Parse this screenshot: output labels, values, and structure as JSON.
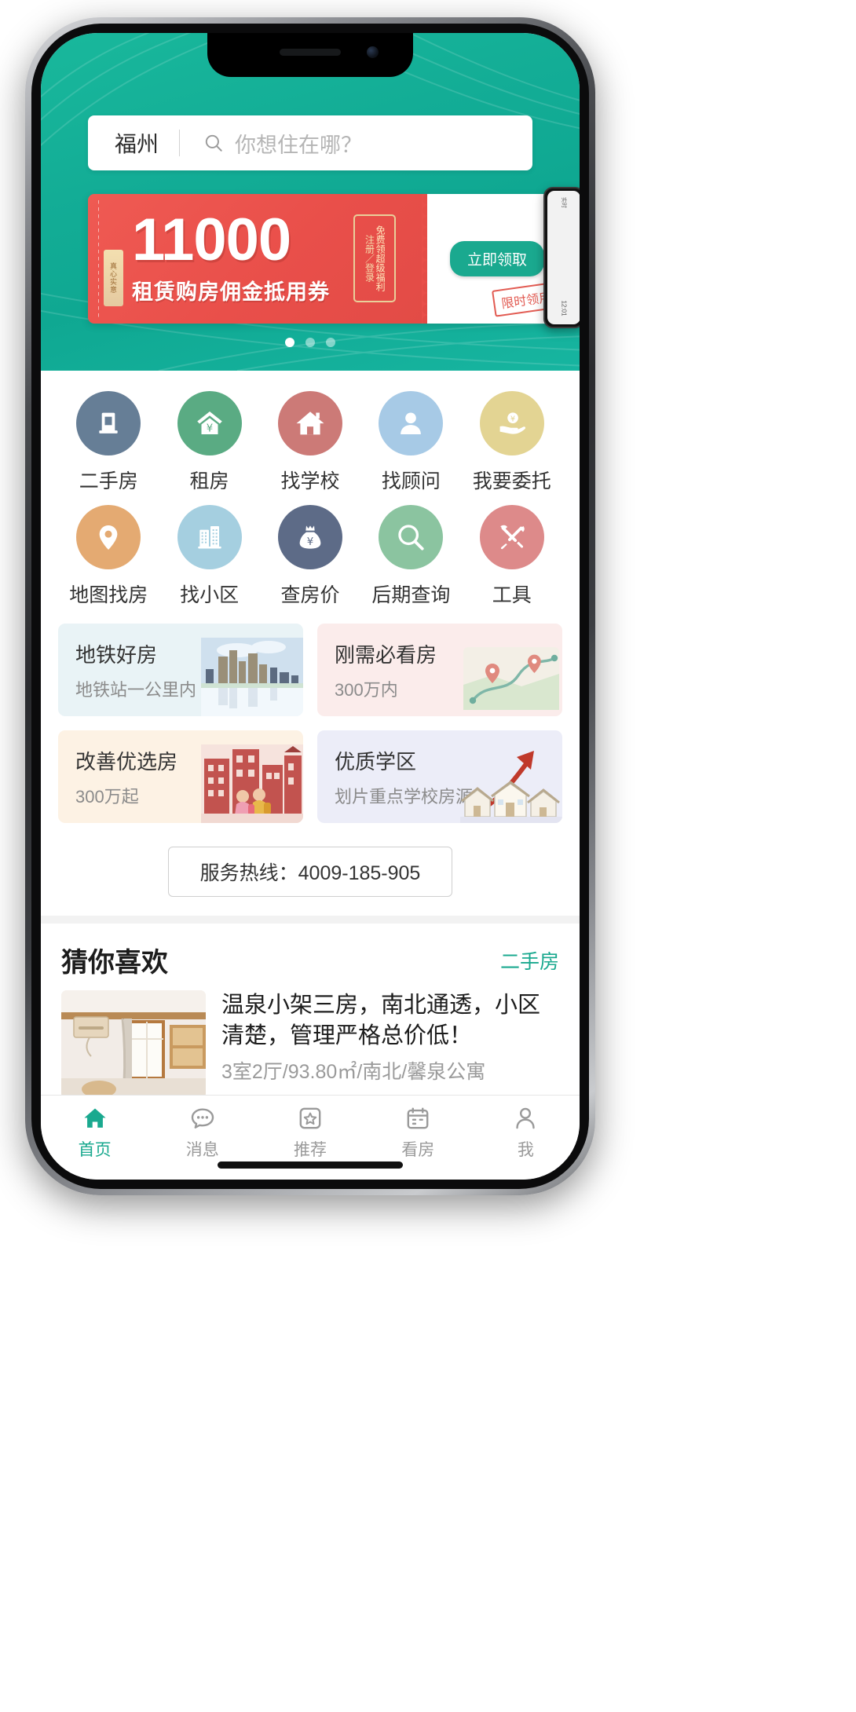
{
  "brand": {
    "accent": "#1aa98f",
    "hero_bg": "#13ad96",
    "coupon_red": "#e94f4a"
  },
  "search": {
    "city": "福州",
    "placeholder": "你想住在哪？",
    "search_icon": "search-icon"
  },
  "banner": {
    "amount": "11000",
    "subtitle": "租赁购房佣金抵用券",
    "seal_text": "真心实意",
    "badge_col1": "注册／登录",
    "badge_col2": "免费领超级福利",
    "cta": "立即领取",
    "stamp": "限时领用",
    "chevron": "‹",
    "dots_total": 3,
    "dots_active": 1
  },
  "mini_phone": {
    "top_label": "实时",
    "bottom_label": "12:01"
  },
  "grid": {
    "items": [
      {
        "label": "二手房",
        "icon": "apartment-building-icon",
        "color": "#667e96"
      },
      {
        "label": "租房",
        "icon": "house-yen-icon",
        "color": "#5aab83"
      },
      {
        "label": "找学校",
        "icon": "home-chimney-icon",
        "color": "#cc7a77"
      },
      {
        "label": "找顾问",
        "icon": "person-avatar-icon",
        "color": "#a7cae6"
      },
      {
        "label": "我要委托",
        "icon": "hand-coin-icon",
        "color": "#e3d493"
      },
      {
        "label": "地图找房",
        "icon": "map-pin-icon",
        "color": "#e4aa72"
      },
      {
        "label": "找小区",
        "icon": "twin-towers-icon",
        "color": "#a5cfe0"
      },
      {
        "label": "查房价",
        "icon": "money-bag-icon",
        "color": "#5d6b87"
      },
      {
        "label": "后期查询",
        "icon": "magnifier-icon",
        "color": "#8bc4a0"
      },
      {
        "label": "工具",
        "icon": "tools-wrench-icon",
        "color": "#dd8a8a"
      }
    ]
  },
  "promos": [
    {
      "title": "地铁好房",
      "sub": "地铁站一公里内",
      "bg": "#e9f3f6",
      "art": "city-skyline-art"
    },
    {
      "title": "刚需必看房",
      "sub": "300万内",
      "bg": "#fbeceb",
      "art": "route-map-art"
    },
    {
      "title": "改善优选房",
      "sub": "300万起",
      "bg": "#fdf2e4",
      "art": "kids-houses-art"
    },
    {
      "title": "优质学区",
      "sub": "划片重点学校房源",
      "bg": "#ecedf8",
      "art": "arrow-houses-art"
    }
  ],
  "hotline": {
    "text": "服务热线：4009-185-905"
  },
  "recommend": {
    "title": "猜你喜欢",
    "more": "二手房",
    "item": {
      "name": "温泉小架三房，南北通透，小区清楚，管理严格总价低！",
      "meta": "3室2厅/93.80㎡/南北/馨泉公寓",
      "thumb": "room-photo"
    }
  },
  "tabbar": {
    "items": [
      {
        "label": "首页",
        "icon": "home-icon",
        "active": true
      },
      {
        "label": "消息",
        "icon": "chat-icon",
        "active": false
      },
      {
        "label": "推荐",
        "icon": "star-box-icon",
        "active": false
      },
      {
        "label": "看房",
        "icon": "calendar-icon",
        "active": false
      },
      {
        "label": "我",
        "icon": "person-icon",
        "active": false
      }
    ]
  }
}
